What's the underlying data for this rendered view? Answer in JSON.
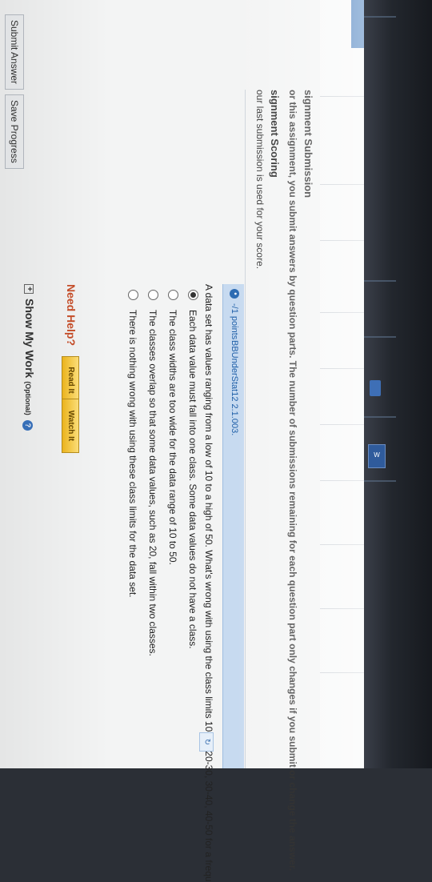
{
  "submission": {
    "heading": "signment Submission",
    "text": "or this assignment, you submit answers by question parts. The number of submissions remaining for each question part only changes if you submit or change the answer."
  },
  "scoring": {
    "heading": "signment Scoring",
    "text": "our last submission is used for your score."
  },
  "question": {
    "points": "-/1 points",
    "code": "BBUnderStat12 2.1.003.",
    "stem": "A data set has values ranging from a low of 10 to a high of 50. What's wrong with using the class limits 10-20, 20-30, 30-40, 40-50 for a frequ",
    "options": [
      {
        "label": "Each data value must fall into one class. Some data values do not have a class.",
        "selected": true
      },
      {
        "label": "The class widths are too wide for the data range of 10 to 50.",
        "selected": false
      },
      {
        "label": "The classes overlap so that some data values, such as 20, fall within two classes.",
        "selected": false
      },
      {
        "label": "There is nothing wrong with using these class limits for the data set.",
        "selected": false
      }
    ]
  },
  "help": {
    "label": "Need Help?",
    "read_it": "Read It",
    "watch_it": "Watch It"
  },
  "show_work": {
    "label": "Show My Work",
    "optional": "(Optional)",
    "help_icon": "?"
  },
  "footer": {
    "submit": "Submit Answer",
    "save": "Save Progress"
  },
  "colors": {
    "accent": "#2f6db5",
    "question_bar": "#c7daf0",
    "need_help": "#c84f2a",
    "help_button": "#f1b81e"
  }
}
